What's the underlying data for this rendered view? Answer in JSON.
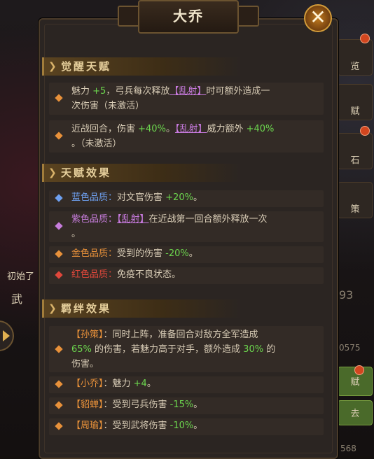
{
  "dialog": {
    "title": "大乔",
    "close_label": "✕"
  },
  "background": {
    "left_label_1": "初始了",
    "left_label_2": "武",
    "right_tabs": [
      "览",
      "赋",
      "石",
      "策"
    ],
    "right_values": [
      "93",
      "0575",
      "568"
    ],
    "right_buttons": [
      "赋",
      "去"
    ]
  },
  "sections": {
    "awakening": {
      "header": "觉醒天赋",
      "entries": [
        {
          "parts": [
            "魅力 ",
            "+5",
            "，弓兵每次释放",
            "【乱射】",
            "时可额外造成一"
          ],
          "line2": "次伤害（未激活）"
        },
        {
          "parts": [
            "近战回合，伤害 ",
            "+40%",
            "。",
            "【乱射】",
            "威力额外 ",
            "+40%"
          ],
          "line2": "。（未激活）"
        }
      ]
    },
    "talent": {
      "header": "天赋效果",
      "entries": [
        {
          "quality": "蓝色品质：",
          "text": "对文官伤害 ",
          "value": "+20%",
          "tail": "。",
          "color": "#6ea0f0"
        },
        {
          "quality": "紫色品质：",
          "skill": "【乱射】",
          "text": "在近战第一回合额外释放一次",
          "line2": "。",
          "color": "#c77ddc"
        },
        {
          "quality": "金色品质：",
          "text": "受到的伤害 ",
          "value": "-20%",
          "tail": "。",
          "color": "#e8913a"
        },
        {
          "quality": "红色品质：",
          "text": "免疫不良状态。",
          "color": "#e0473b"
        }
      ]
    },
    "bond": {
      "header": "羁绊效果",
      "entries": [
        {
          "name": "【孙策】",
          "line1": "：同时上阵，准备回合对敌方全军造成",
          "v1": "65%",
          "line2": " 的伤害，若魅力高于对手，额外造成 ",
          "v2": "30%",
          "line2b": " 的",
          "line3": "伤害。"
        },
        {
          "name": "【小乔】",
          "text": "：魅力 ",
          "value": "+4",
          "tail": "。"
        },
        {
          "name": "【貂蝉】",
          "text": "：受到弓兵伤害 ",
          "value": "-15%",
          "tail": "。"
        },
        {
          "name": "【周瑜】",
          "text": "：受到武将伤害 ",
          "value": "-10%",
          "tail": "。"
        }
      ]
    }
  },
  "colors": {
    "accent": "#e8913a",
    "positive": "#6cd64e",
    "skill": "#c97be0"
  }
}
